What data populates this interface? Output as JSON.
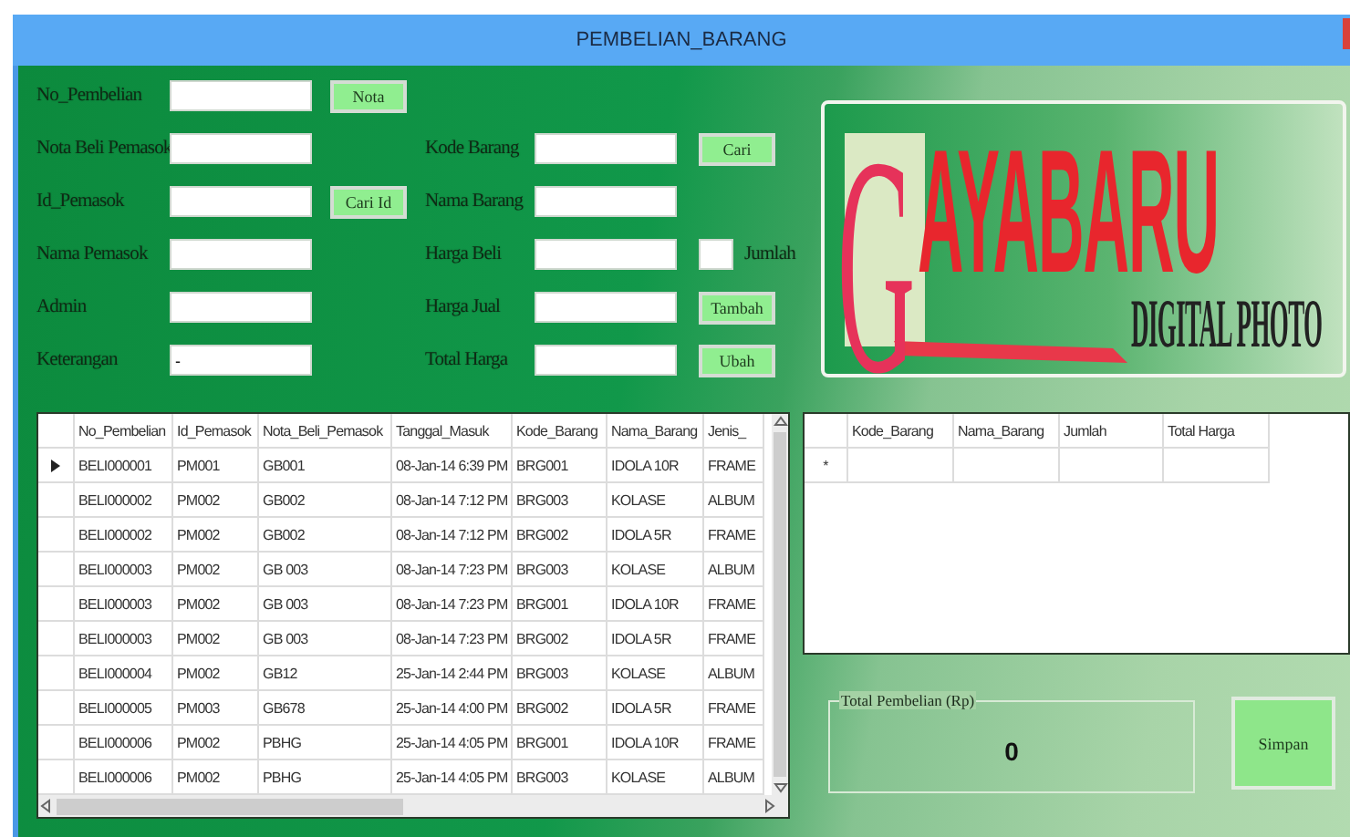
{
  "window": {
    "title": "PEMBELIAN_BARANG"
  },
  "supplier_fields": [
    {
      "label": "No_Pembelian",
      "button": "Nota"
    },
    {
      "label": "Nota Beli Pemasok"
    },
    {
      "label": "Id_Pemasok",
      "button": "Cari Id"
    },
    {
      "label": "Nama Pemasok"
    },
    {
      "label": "Admin"
    },
    {
      "label": "Keterangan",
      "value": "-"
    }
  ],
  "item_fields": [
    {
      "label": "Kode Barang",
      "button": "Cari"
    },
    {
      "label": "Nama Barang"
    },
    {
      "label": "Harga Beli",
      "extra_field": {
        "label": "Jumlah"
      }
    },
    {
      "label": "Harga Jual",
      "button": "Tambah"
    },
    {
      "label": "Total Harga",
      "button": "Ubah"
    }
  ],
  "logo": {
    "initial": "G",
    "name": "AYABARU",
    "tagline": "DIGITAL PHOTO"
  },
  "purchases_table": {
    "columns": [
      "No_Pembelian",
      "Id_Pemasok",
      "Nota_Beli_Pemasok",
      "Tanggal_Masuk",
      "Kode_Barang",
      "Nama_Barang",
      "Jenis_"
    ],
    "rows": [
      {
        "selected": true,
        "cells": [
          "BELI000001",
          "PM001",
          "GB001",
          "08-Jan-14 6:39 PM",
          "BRG001",
          "IDOLA 10R",
          "FRAME"
        ]
      },
      {
        "selected": false,
        "cells": [
          "BELI000002",
          "PM002",
          "GB002",
          "08-Jan-14 7:12 PM",
          "BRG003",
          "KOLASE",
          "ALBUM"
        ]
      },
      {
        "selected": false,
        "cells": [
          "BELI000002",
          "PM002",
          "GB002",
          "08-Jan-14 7:12 PM",
          "BRG002",
          "IDOLA 5R",
          "FRAME"
        ]
      },
      {
        "selected": false,
        "cells": [
          "BELI000003",
          "PM002",
          "GB 003",
          "08-Jan-14 7:23 PM",
          "BRG003",
          "KOLASE",
          "ALBUM"
        ]
      },
      {
        "selected": false,
        "cells": [
          "BELI000003",
          "PM002",
          "GB 003",
          "08-Jan-14 7:23 PM",
          "BRG001",
          "IDOLA 10R",
          "FRAME"
        ]
      },
      {
        "selected": false,
        "cells": [
          "BELI000003",
          "PM002",
          "GB 003",
          "08-Jan-14 7:23 PM",
          "BRG002",
          "IDOLA 5R",
          "FRAME"
        ]
      },
      {
        "selected": false,
        "cells": [
          "BELI000004",
          "PM002",
          "GB12",
          "25-Jan-14 2:44 PM",
          "BRG003",
          "KOLASE",
          "ALBUM"
        ]
      },
      {
        "selected": false,
        "cells": [
          "BELI000005",
          "PM003",
          "GB678",
          "25-Jan-14 4:00 PM",
          "BRG002",
          "IDOLA 5R",
          "FRAME"
        ]
      },
      {
        "selected": false,
        "cells": [
          "BELI000006",
          "PM002",
          "PBHG",
          "25-Jan-14 4:05 PM",
          "BRG001",
          "IDOLA 10R",
          "FRAME"
        ]
      },
      {
        "selected": false,
        "cells": [
          "BELI000006",
          "PM002",
          "PBHG",
          "25-Jan-14 4:05 PM",
          "BRG003",
          "KOLASE",
          "ALBUM"
        ]
      }
    ]
  },
  "cart_table": {
    "columns": [
      "Kode_Barang",
      "Nama_Barang",
      "Jumlah",
      "Total Harga"
    ],
    "new_row_marker": "*"
  },
  "total": {
    "label": "Total Pembelian (Rp)",
    "value": "0"
  },
  "save_button": "Simpan"
}
